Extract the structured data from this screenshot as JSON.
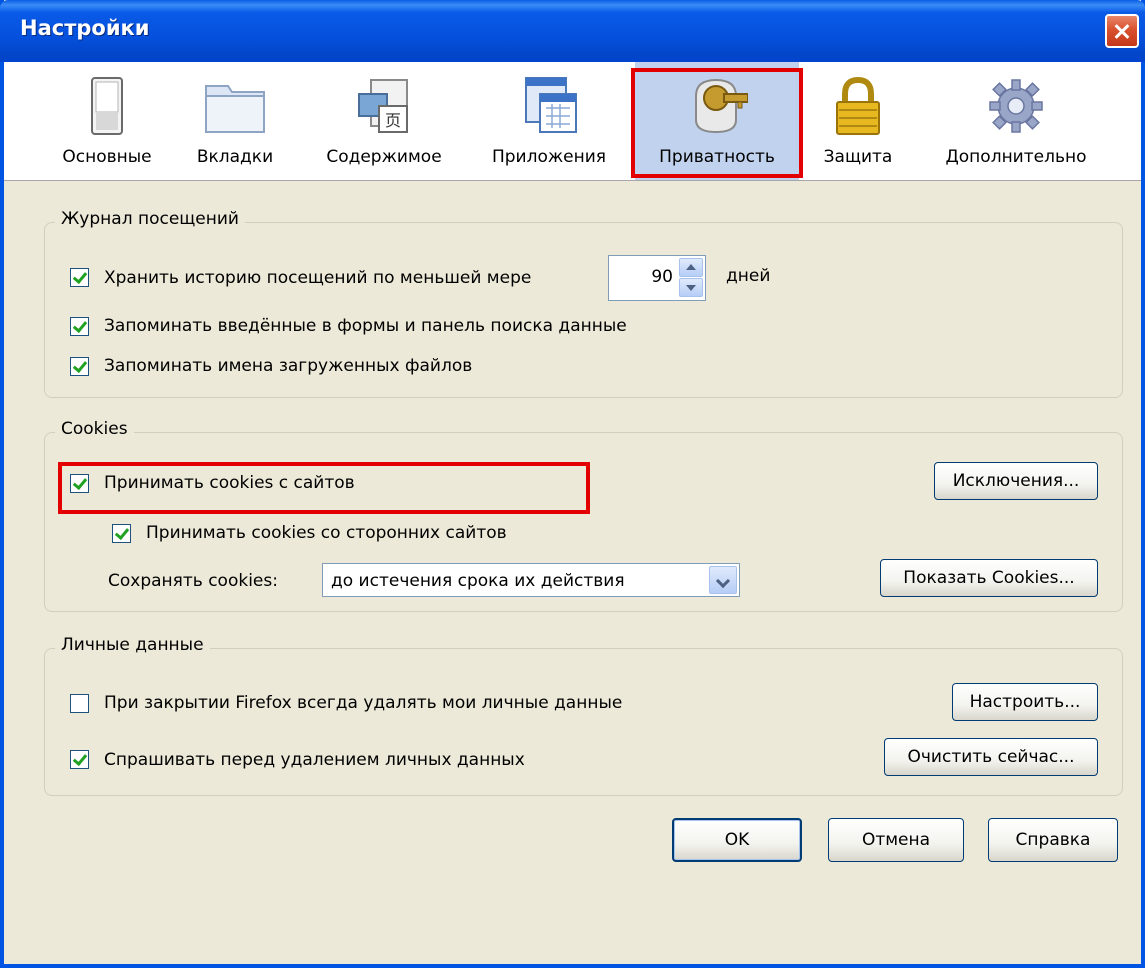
{
  "window": {
    "title": "Настройки"
  },
  "toolbar": {
    "tabs": [
      {
        "label": "Основные",
        "icon": "switch-icon"
      },
      {
        "label": "Вкладки",
        "icon": "folder-tabs-icon"
      },
      {
        "label": "Содержимое",
        "icon": "content-icon"
      },
      {
        "label": "Приложения",
        "icon": "applications-icon"
      },
      {
        "label": "Приватность",
        "icon": "privacy-mask-icon",
        "selected": true
      },
      {
        "label": "Защита",
        "icon": "padlock-icon"
      },
      {
        "label": "Дополнительно",
        "icon": "gear-icon"
      }
    ]
  },
  "history": {
    "legend": "Журнал посещений",
    "keep_history_label": "Хранить историю посещений по меньшей мере",
    "keep_history_checked": true,
    "days_value": "90",
    "days_label": "дней",
    "remember_forms_label": "Запоминать введённые в формы и панель поиска данные",
    "remember_forms_checked": true,
    "remember_downloads_label": "Запоминать имена загруженных файлов",
    "remember_downloads_checked": true
  },
  "cookies": {
    "legend": "Cookies",
    "accept_label": "Принимать cookies с сайтов",
    "accept_checked": true,
    "exceptions_button": "Исключения...",
    "third_party_label": "Принимать cookies со сторонних сайтов",
    "third_party_checked": true,
    "keep_label": "Сохранять cookies:",
    "keep_value": "до истечения срока их действия",
    "show_cookies_button": "Показать Cookies..."
  },
  "private_data": {
    "legend": "Личные данные",
    "clear_on_close_label": "При закрытии Firefox всегда удалять мои личные данные",
    "clear_on_close_checked": false,
    "settings_button": "Настроить...",
    "ask_before_label": "Спрашивать перед удалением личных данных",
    "ask_before_checked": true,
    "clear_now_button": "Очистить сейчас..."
  },
  "footer": {
    "ok_button": "OK",
    "cancel_button": "Отмена",
    "help_button": "Справка"
  },
  "colors": {
    "highlight": "#e30000",
    "titlebar": "#0550dc",
    "dialog_bg": "#ece9d8",
    "selected_tab": "#c1d2ee"
  }
}
